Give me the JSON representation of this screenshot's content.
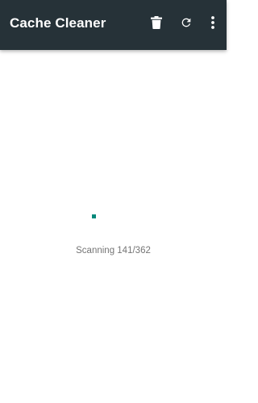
{
  "app_bar": {
    "title": "Cache Cleaner",
    "background_color": "#263238",
    "actions": [
      {
        "name": "delete",
        "icon": "trash-icon"
      },
      {
        "name": "refresh",
        "icon": "refresh-icon"
      },
      {
        "name": "more",
        "icon": "more-vert-icon"
      }
    ]
  },
  "main": {
    "spinner_color": "#00897b",
    "status_text": "Scanning 141/362",
    "scan_progress": {
      "scanned": 141,
      "total": 362
    }
  }
}
